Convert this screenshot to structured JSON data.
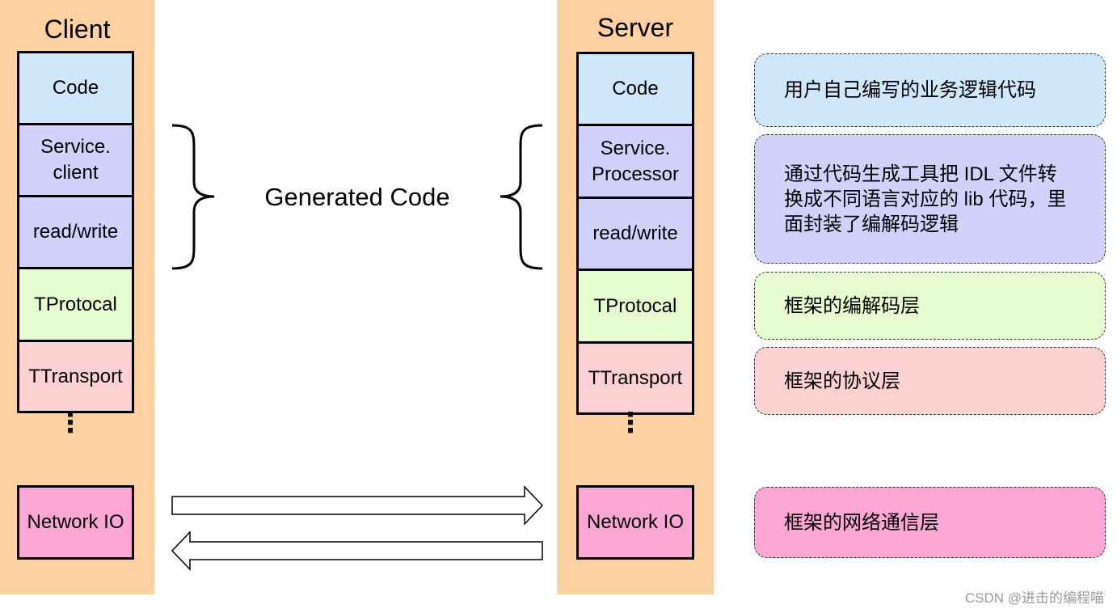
{
  "client": {
    "title": "Client",
    "layers": [
      "Code",
      "Service.\nclient",
      "read/write",
      "TProtocal",
      "TTransport"
    ],
    "network": "Network IO"
  },
  "server": {
    "title": "Server",
    "layers": [
      "Code",
      "Service.\nProcessor",
      "read/write",
      "TProtocal",
      "TTransport"
    ],
    "network": "Network IO"
  },
  "generated_label": "Generated Code",
  "descriptions": [
    "用户自己编写的业务逻辑代码",
    "通过代码生成工具把 IDL 文件转换成不同语言对应的 lib 代码，里面封装了编解码逻辑",
    "框架的编解码层",
    "框架的协议层",
    "框架的网络通信层"
  ],
  "watermark": "CSDN @进击的编程喵",
  "colors": {
    "column": "#fdd1a2",
    "code": "#d0e6fb",
    "service": "#d1d1fb",
    "protocol": "#e6fbcf",
    "transport": "#fdd1d1",
    "network": "#fba6d4"
  }
}
